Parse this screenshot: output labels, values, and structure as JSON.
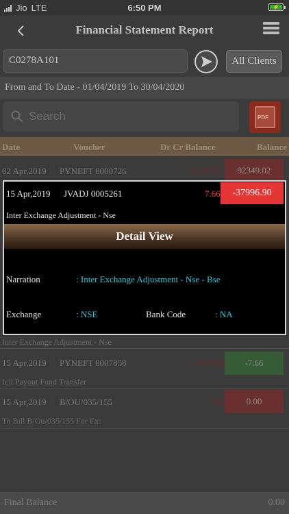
{
  "status_bar": {
    "carrier": "Jio",
    "network": "LTE",
    "time": "6:50 PM"
  },
  "header": {
    "title": "Financial Statement Report"
  },
  "client": {
    "code": "C0278A101",
    "all_clients_label": "All Clients"
  },
  "date_range": "From and To Date - 01/04/2019 To 30/04/2020",
  "search": {
    "placeholder": "Search"
  },
  "pdf_label": "PDF",
  "columns": {
    "date": "Date",
    "voucher": "Voucher",
    "drcr": "Dr Cr Balance",
    "balance": "Balance"
  },
  "rows": [
    {
      "date": "02 Apr,2019",
      "voucher": "PYNEFT 0000726",
      "drcr": "92349.02",
      "balance": "92349.02"
    },
    {
      "narration": "Inter Exchange Adjustment - Nse"
    },
    {
      "date": "15 Apr,2019",
      "voucher": "PYNEFT 0007858",
      "drcr": "-7000.00",
      "balance": "-7.66",
      "narration": "Icil Payout Fund Transfer"
    },
    {
      "date": "15 Apr,2019",
      "voucher": "B/OU/035/155",
      "drcr": "7.66",
      "balance": "0.00",
      "narration": "To Bill B/Ou/035/155   For Ex:"
    }
  ],
  "footer": {
    "label": "Final  Balance",
    "value": "0.00"
  },
  "detail": {
    "date": "15 Apr,2019",
    "voucher": "JVADJ  0005261",
    "drcr": "7.66",
    "balance": "-37996.90",
    "narration_line": "Inter Exchange Adjustment - Nse",
    "title": "Detail View",
    "narration_label": "Narration",
    "narration_value": ": Inter Exchange Adjustment - Nse - Bse",
    "exchange_label": "Exchange",
    "exchange_value": ": NSE",
    "bank_code_label": "Bank Code",
    "bank_code_value": ": NA"
  },
  "colors": {
    "balance_negative": "#e53535",
    "value_text": "#33c6d9",
    "header_brown": "#6e5a44"
  }
}
